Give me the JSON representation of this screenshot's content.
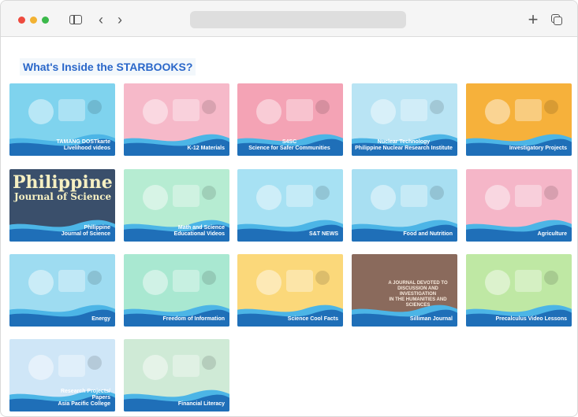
{
  "browser": {
    "toolbar": {
      "sidebar_icon": "sidebar-icon",
      "back_glyph": "‹",
      "forward_glyph": "›",
      "new_tab_glyph": "+",
      "tabs_icon": "tabs-overview-icon"
    }
  },
  "page": {
    "heading": "What's Inside the STARBOOKS?"
  },
  "tiles": [
    {
      "label": "TAMANG DOSTkarte\nLivelihood videos",
      "bg": "#7fd3ee"
    },
    {
      "label": "K-12 Materials",
      "bg": "#f6b9c9"
    },
    {
      "label": "S4SC\nScience for Safer Communities",
      "bg": "#f4a3b5"
    },
    {
      "label": "Nuclear Technology\nPhilippine Nuclear Research Institute",
      "bg": "#b9e4f4"
    },
    {
      "label": "Investigatory Projects",
      "bg": "#f6b13b"
    },
    {
      "label": "Philippine\nJournal of Science",
      "bg": "#3a4f6b",
      "overlay_title": "Philippine",
      "overlay_sub": "Journal of Science"
    },
    {
      "label": "Math and Science\nEducational Videos",
      "bg": "#b6ecd2"
    },
    {
      "label": "S&T NEWS",
      "bg": "#a7e1f3"
    },
    {
      "label": "Food and Nutrition",
      "bg": "#a8dff2"
    },
    {
      "label": "Agriculture",
      "bg": "#f5b6c8"
    },
    {
      "label": "Energy",
      "bg": "#9edcf1"
    },
    {
      "label": "Freedom of Information",
      "bg": "#a9e8d1"
    },
    {
      "label": "Science Cool Facts",
      "bg": "#fbd87a"
    },
    {
      "label": "Silliman Journal",
      "bg": "#8a6a5c",
      "overlay_text": "A JOURNAL DEVOTED TO\nDISCUSSION AND INVESTIGATION\nIN THE HUMANITIES AND SCIENCES"
    },
    {
      "label": "Precalculus Video Lessons",
      "bg": "#bfe8a4"
    },
    {
      "label": "Research Projects/\nPapers\nAsia Pacific College",
      "bg": "#cfe6f7"
    },
    {
      "label": "Financial Literacy",
      "bg": "#cfead6"
    }
  ]
}
